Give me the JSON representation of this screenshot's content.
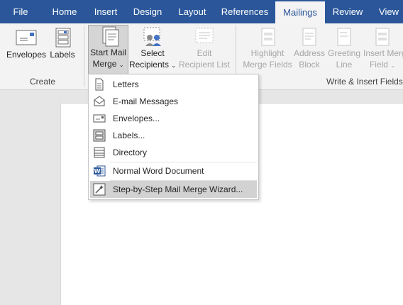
{
  "tabs": [
    {
      "id": "file",
      "label": "File"
    },
    {
      "id": "home",
      "label": "Home"
    },
    {
      "id": "insert",
      "label": "Insert"
    },
    {
      "id": "design",
      "label": "Design"
    },
    {
      "id": "layout",
      "label": "Layout"
    },
    {
      "id": "references",
      "label": "References"
    },
    {
      "id": "mailings",
      "label": "Mailings",
      "active": true
    },
    {
      "id": "review",
      "label": "Review"
    },
    {
      "id": "view",
      "label": "View"
    }
  ],
  "ribbon": {
    "envelopes": "Envelopes",
    "labels": "Labels",
    "start_mail_merge_1": "Start Mail",
    "start_mail_merge_2": "Merge",
    "select_recipients_1": "Select",
    "select_recipients_2": "Recipients",
    "edit_recipient_list_1": "Edit",
    "edit_recipient_list_2": "Recipient List",
    "highlight_merge_fields_1": "Highlight",
    "highlight_merge_fields_2": "Merge Fields",
    "address_block_1": "Address",
    "address_block_2": "Block",
    "greeting_line_1": "Greeting",
    "greeting_line_2": "Line",
    "insert_merge_field_1": "Insert Merge",
    "insert_merge_field_2": "Field",
    "group_create": "Create",
    "group_write_insert": "Write & Insert Fields",
    "caret": "⌄"
  },
  "menu": {
    "letters": "Letters",
    "email": "E-mail Messages",
    "envelopes": "Envelopes...",
    "labels": "Labels...",
    "directory": "Directory",
    "normal": "Normal Word Document",
    "wizard": "Step-by-Step Mail Merge Wizard..."
  },
  "colors": {
    "accent": "#2b579a",
    "word_icon": "#2b579a"
  }
}
